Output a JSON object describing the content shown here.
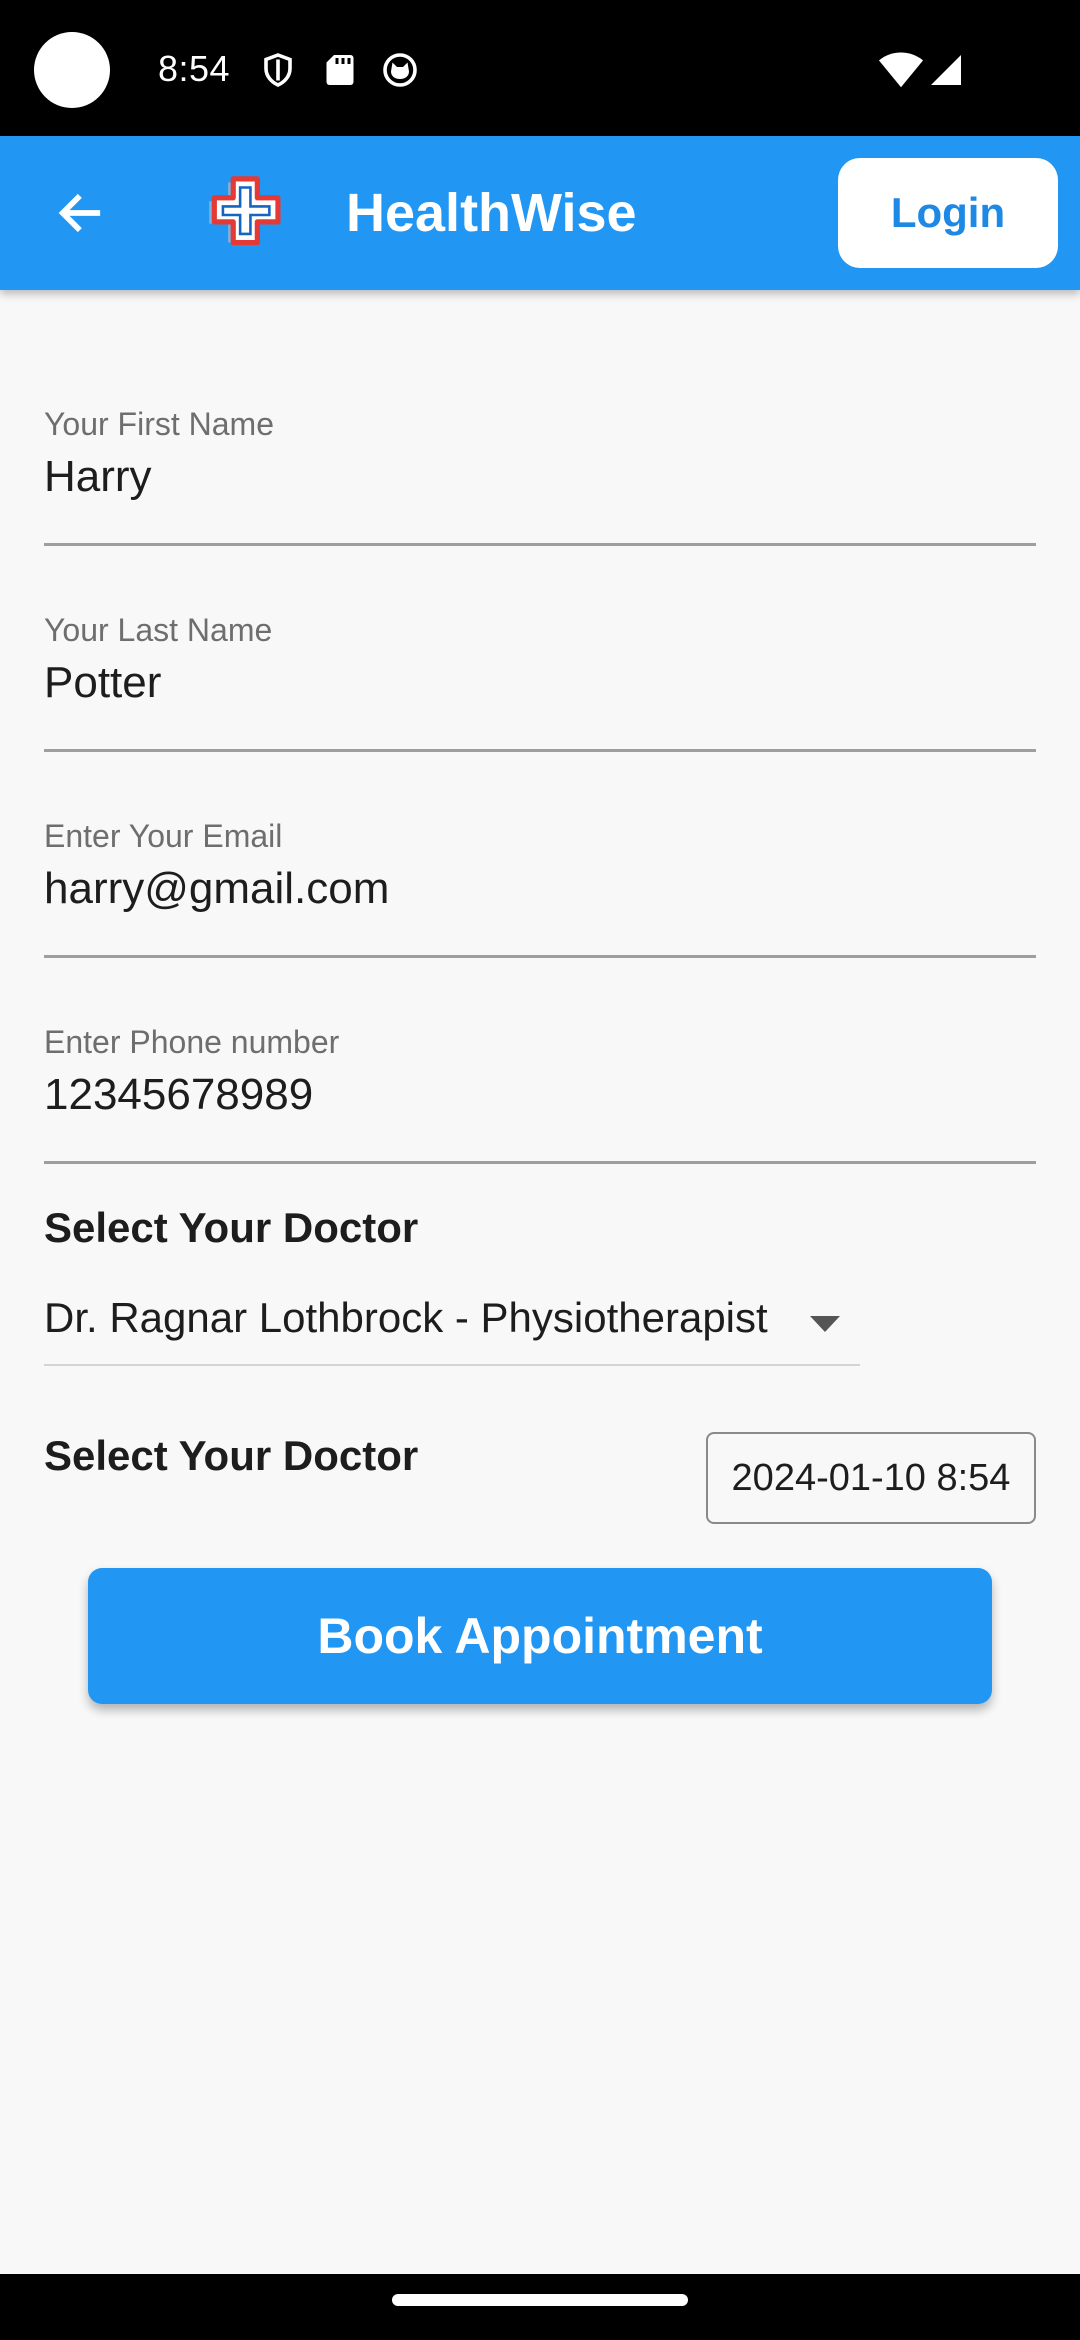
{
  "status_bar": {
    "time": "8:54",
    "icons": [
      "shield-icon",
      "sd-card-icon",
      "cat-face-icon",
      "wifi-icon",
      "cell-signal-icon"
    ]
  },
  "app_bar": {
    "title": "HealthWise",
    "login_label": "Login",
    "back_icon": "arrow-left-icon",
    "logo_icon": "medical-cross-logo",
    "color": "#2196f3"
  },
  "form": {
    "first_name": {
      "label": "Your First Name",
      "value": "Harry"
    },
    "last_name": {
      "label": "Your Last Name",
      "value": "Potter"
    },
    "email": {
      "label": "Enter Your Email",
      "value": "harry@gmail.com"
    },
    "phone": {
      "label": "Enter Phone number",
      "value": "12345678989"
    },
    "doctor_section_label": "Select Your Doctor",
    "doctor_selected": "Dr. Ragnar Lothbrock - Physiotherapist",
    "datetime_section_label": "Select Your Doctor",
    "datetime_value": "2024-01-10 8:54",
    "submit_label": "Book Appointment"
  }
}
